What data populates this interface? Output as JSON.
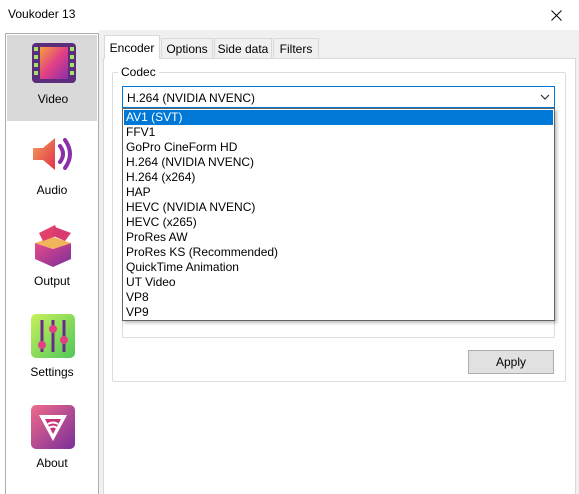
{
  "window": {
    "title": "Voukoder 13"
  },
  "sidebar": {
    "items": [
      {
        "label": "Video",
        "icon": "film-icon",
        "selected": true
      },
      {
        "label": "Audio",
        "icon": "speaker-icon",
        "selected": false
      },
      {
        "label": "Output",
        "icon": "box-icon",
        "selected": false
      },
      {
        "label": "Settings",
        "icon": "sliders-icon",
        "selected": false
      },
      {
        "label": "About",
        "icon": "voukoder-logo-icon",
        "selected": false
      }
    ]
  },
  "tabs": [
    {
      "label": "Encoder",
      "active": true
    },
    {
      "label": "Options",
      "active": false
    },
    {
      "label": "Side data",
      "active": false
    },
    {
      "label": "Filters",
      "active": false
    }
  ],
  "codec": {
    "group_label": "Codec",
    "selected_value": "H.264 (NVIDIA NVENC)",
    "options": [
      "AV1 (SVT)",
      "FFV1",
      "GoPro CineForm HD",
      "H.264 (NVIDIA NVENC)",
      "H.264 (x264)",
      "HAP",
      "HEVC (NVIDIA NVENC)",
      "HEVC (x265)",
      "ProRes AW",
      "ProRes KS (Recommended)",
      "QuickTime Animation",
      "UT Video",
      "VP8",
      "VP9"
    ],
    "highlighted_index": 0
  },
  "apply_label": "Apply",
  "colors": {
    "accent": "#0078d7",
    "selected_nav": "#d9d9d9",
    "panel_bg": "#f0f0f0"
  }
}
